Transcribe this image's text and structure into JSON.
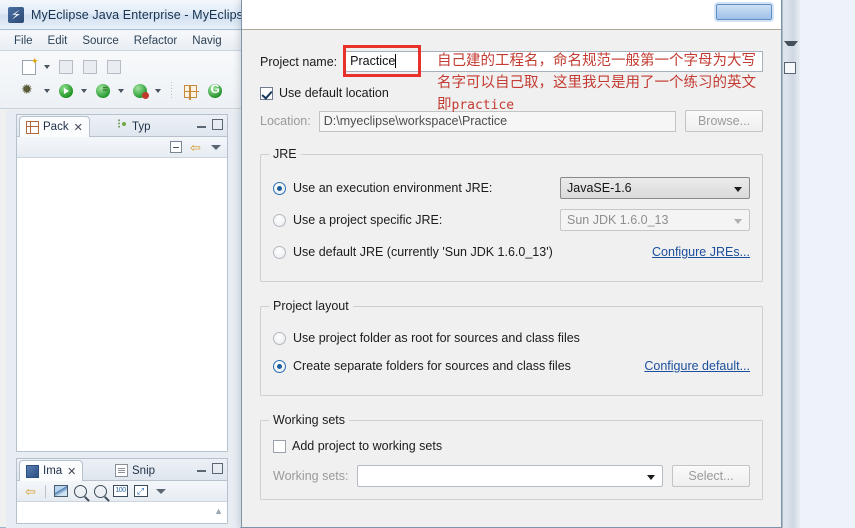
{
  "window": {
    "title": "MyEclipse Java Enterprise - MyEclips",
    "app_icon": "myeclipse-icon"
  },
  "menubar": {
    "items": [
      "File",
      "Edit",
      "Source",
      "Refactor",
      "Navig"
    ]
  },
  "toolbar": {
    "row1_icons": [
      "new-file-icon",
      "dropdown-arrow",
      "save-icon",
      "save-all-icon",
      "print-icon"
    ],
    "row2_icons": [
      "debug-icon",
      "dropdown-arrow",
      "run-icon",
      "dropdown-arrow",
      "run-config-icon",
      "dropdown-arrow",
      "run-server-icon",
      "dropdown-arrow",
      "new-wizard-icon",
      "refresh-icon"
    ]
  },
  "views": {
    "package_explorer": {
      "tabs": [
        {
          "label": "Pack",
          "icon": "package-icon",
          "active": true,
          "close": "✕"
        },
        {
          "label": "Typ",
          "icon": "type-hierarchy-icon",
          "active": false
        }
      ],
      "toolbar_icons": [
        "collapse-all-icon",
        "link-with-editor-icon",
        "view-menu-icon"
      ],
      "controls": [
        "minimize-icon",
        "maximize-icon"
      ]
    },
    "image_view": {
      "tabs": [
        {
          "label": "Ima",
          "icon": "image-icon",
          "active": true,
          "close": "✕"
        },
        {
          "label": "Snip",
          "icon": "snippets-icon",
          "active": false
        }
      ],
      "toolbar_icons": [
        "link-with-editor-icon",
        "picture-icon",
        "zoom-out-icon",
        "zoom-in-icon",
        "zoom-100-icon",
        "fit-to-window-icon",
        "view-menu-icon"
      ],
      "zoom_100_label": "100",
      "controls": [
        "minimize-icon",
        "maximize-icon"
      ]
    }
  },
  "dialog": {
    "top_strip": {
      "ghost_text_1": "",
      "ghost_text_2": "",
      "button": "highlighted-button"
    },
    "project_name": {
      "label": "Project name:",
      "value": "Practice",
      "placeholder": ""
    },
    "use_default_location": {
      "label": "Use default location",
      "checked": true
    },
    "location": {
      "label": "Location:",
      "value": "D:\\myeclipse\\workspace\\Practice",
      "browse_button": "Browse..."
    },
    "jre": {
      "title": "JRE",
      "options": [
        {
          "label": "Use an execution environment JRE:",
          "selected": true
        },
        {
          "label": "Use a project specific JRE:",
          "selected": false
        },
        {
          "label": "Use default JRE (currently 'Sun JDK 1.6.0_13')",
          "selected": false
        }
      ],
      "execution_env_value": "JavaSE-1.6",
      "specific_jre_value": "Sun JDK 1.6.0_13",
      "configure_link": "Configure JREs..."
    },
    "project_layout": {
      "title": "Project layout",
      "options": [
        {
          "label": "Use project folder as root for sources and class files",
          "selected": false
        },
        {
          "label": "Create separate folders for sources and class files",
          "selected": true
        }
      ],
      "configure_link": "Configure default..."
    },
    "working_sets": {
      "title": "Working sets",
      "add_checkbox_label": "Add project to working sets",
      "add_checked": false,
      "label": "Working sets:",
      "value": "",
      "select_button": "Select..."
    }
  },
  "annotation": {
    "color": "#c33b32",
    "box_color": "#e8312a",
    "lines": [
      "自己建的工程名，命名规范一般第一个字母为大写",
      "名字可以自己取，这里我只是用了一个练习的英文",
      "即practice"
    ],
    "line3_prefix": "即",
    "line3_mono": "practice"
  }
}
